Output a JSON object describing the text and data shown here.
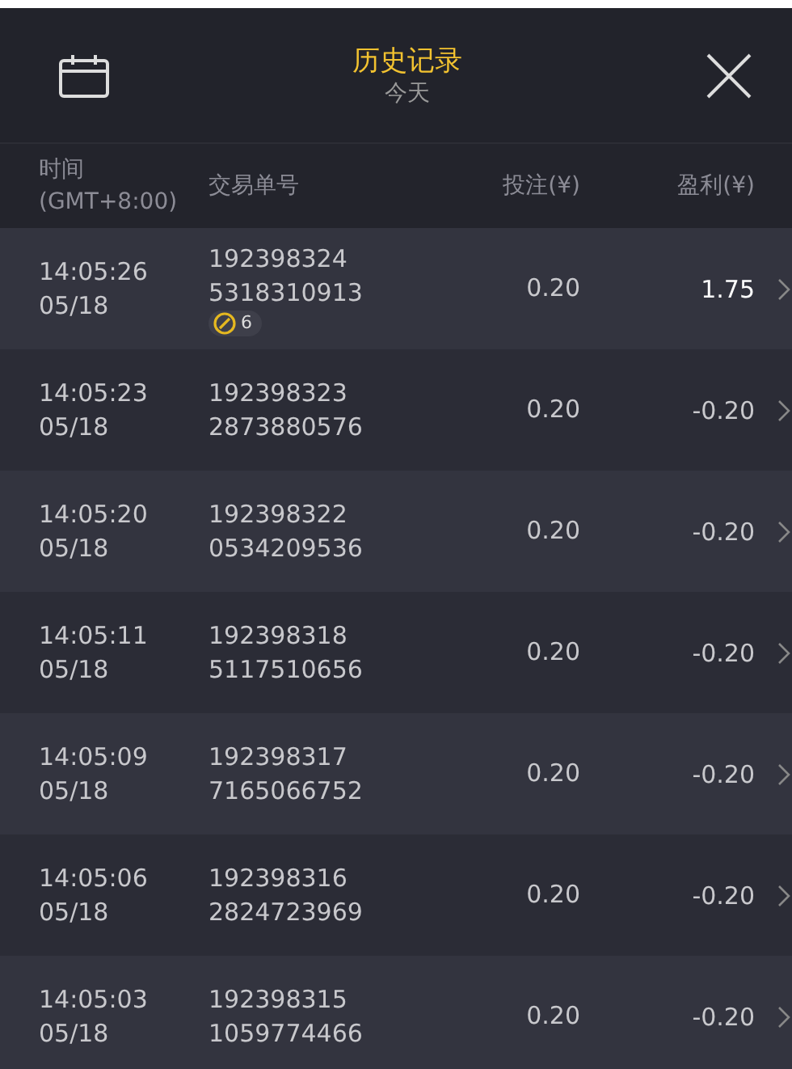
{
  "header": {
    "title": "历史记录",
    "subtitle": "今天"
  },
  "columns": [
    {
      "label": "时间\n(GMT+8:00)"
    },
    {
      "label": "交易单号"
    },
    {
      "label": "投注(¥)"
    },
    {
      "label": "盈利(¥)"
    }
  ],
  "rows": [
    {
      "time": "14:05:26",
      "date": "05/18",
      "id1": "192398324",
      "id2": "5318310913",
      "badge": "6",
      "stake": "0.20",
      "profit": "1.75",
      "kind": "win"
    },
    {
      "time": "14:05:23",
      "date": "05/18",
      "id1": "192398323",
      "id2": "2873880576",
      "stake": "0.20",
      "profit": "-0.20",
      "kind": "loss"
    },
    {
      "time": "14:05:20",
      "date": "05/18",
      "id1": "192398322",
      "id2": "0534209536",
      "stake": "0.20",
      "profit": "-0.20",
      "kind": "loss"
    },
    {
      "time": "14:05:11",
      "date": "05/18",
      "id1": "192398318",
      "id2": "5117510656",
      "stake": "0.20",
      "profit": "-0.20",
      "kind": "loss"
    },
    {
      "time": "14:05:09",
      "date": "05/18",
      "id1": "192398317",
      "id2": "7165066752",
      "stake": "0.20",
      "profit": "-0.20",
      "kind": "loss"
    },
    {
      "time": "14:05:06",
      "date": "05/18",
      "id1": "192398316",
      "id2": "2824723969",
      "stake": "0.20",
      "profit": "-0.20",
      "kind": "loss"
    },
    {
      "time": "14:05:03",
      "date": "05/18",
      "id1": "192398315",
      "id2": "1059774466",
      "stake": "0.20",
      "profit": "-0.20",
      "kind": "loss"
    }
  ]
}
